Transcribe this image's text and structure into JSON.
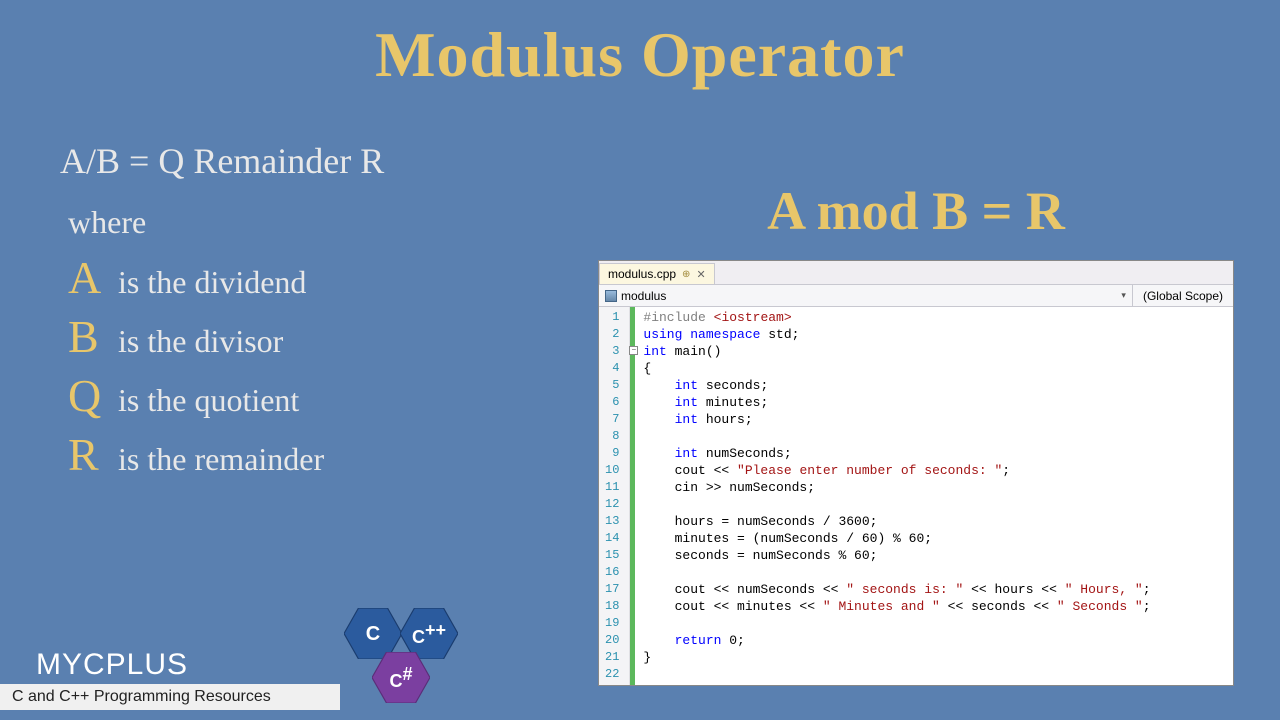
{
  "title": "Modulus Operator",
  "left": {
    "formula": "A/B = Q Remainder R",
    "where": "where",
    "defs": [
      {
        "letter": "A",
        "text": "is the dividend"
      },
      {
        "letter": "B",
        "text": "is the divisor"
      },
      {
        "letter": "Q",
        "text": "is the quotient"
      },
      {
        "letter": "R",
        "text": "is the remainder"
      }
    ]
  },
  "right": {
    "mod_expression": "A mod B = R"
  },
  "editor": {
    "tab_label": "modulus.cpp",
    "scope_left": "modulus",
    "scope_right": "(Global Scope)",
    "lines": [
      {
        "n": 1,
        "html": "<span class=\"pp\">#include</span> <span class=\"str\">&lt;iostream&gt;</span>"
      },
      {
        "n": 2,
        "html": "<span class=\"kw\">using</span> <span class=\"kw\">namespace</span> std;"
      },
      {
        "n": 3,
        "html": "<span class=\"kw\">int</span> main()",
        "fold": true
      },
      {
        "n": 4,
        "html": "{"
      },
      {
        "n": 5,
        "html": "    <span class=\"kw\">int</span> seconds;"
      },
      {
        "n": 6,
        "html": "    <span class=\"kw\">int</span> minutes;"
      },
      {
        "n": 7,
        "html": "    <span class=\"kw\">int</span> hours;"
      },
      {
        "n": 8,
        "html": "    "
      },
      {
        "n": 9,
        "html": "    <span class=\"kw\">int</span> numSeconds;"
      },
      {
        "n": 10,
        "html": "    cout &lt;&lt; <span class=\"str\">\"Please enter number of seconds: \"</span>;"
      },
      {
        "n": 11,
        "html": "    cin &gt;&gt; numSeconds;"
      },
      {
        "n": 12,
        "html": ""
      },
      {
        "n": 13,
        "html": "    hours = numSeconds / 3600;"
      },
      {
        "n": 14,
        "html": "    minutes = (numSeconds / 60) % 60;"
      },
      {
        "n": 15,
        "html": "    seconds = numSeconds % 60;"
      },
      {
        "n": 16,
        "html": ""
      },
      {
        "n": 17,
        "html": "    cout &lt;&lt; numSeconds &lt;&lt; <span class=\"str\">\" seconds is: \"</span> &lt;&lt; hours &lt;&lt; <span class=\"str\">\" Hours, \"</span>;"
      },
      {
        "n": 18,
        "html": "    cout &lt;&lt; minutes &lt;&lt; <span class=\"str\">\" Minutes and \"</span> &lt;&lt; seconds &lt;&lt; <span class=\"str\">\" Seconds \"</span>;"
      },
      {
        "n": 19,
        "html": ""
      },
      {
        "n": 20,
        "html": "    <span class=\"kw\">return</span> 0;"
      },
      {
        "n": 21,
        "html": "}"
      },
      {
        "n": 22,
        "html": ""
      }
    ]
  },
  "brand": {
    "name": "MYCPLUS",
    "tagline": "C and C++ Programming Resources"
  },
  "logos": {
    "c": "C",
    "cpp_main": "C",
    "cpp_sup": "++",
    "cs_main": "C",
    "cs_sup": "#"
  },
  "colors": {
    "hex_c": "#2b5b9e",
    "hex_cpp": "#2b5b9e",
    "hex_cs": "#7b3fa0"
  }
}
